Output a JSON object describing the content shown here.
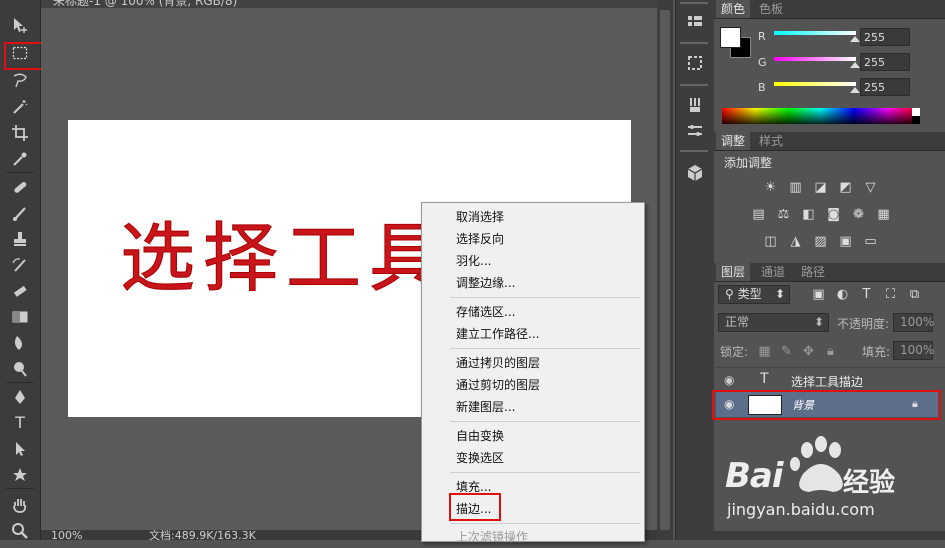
{
  "document": {
    "tab_title": "未标题-1 @ 100% (背景, RGB/8)",
    "canvas_text": "选择工具",
    "status_zoom": "100%",
    "status_info": "文档:489.9K/163.3K"
  },
  "toolbar": {
    "tools": [
      "move-tool",
      "rect-marquee-tool",
      "lasso-tool",
      "quick-select-tool",
      "crop-tool",
      "eyedropper-tool",
      "healing-brush-tool",
      "brush-tool",
      "clone-stamp-tool",
      "history-brush-tool",
      "eraser-tool",
      "gradient-tool",
      "blur-tool",
      "dodge-tool",
      "pen-tool",
      "type-tool",
      "path-select-tool",
      "shape-tool",
      "hand-tool",
      "zoom-tool"
    ],
    "type_tool_glyph": "T"
  },
  "context_menu": {
    "items": [
      {
        "label": "取消选择"
      },
      {
        "label": "选择反向"
      },
      {
        "label": "羽化..."
      },
      {
        "label": "调整边缘..."
      },
      {
        "label": "存储选区..."
      },
      {
        "label": "建立工作路径..."
      },
      {
        "label": "通过拷贝的图层"
      },
      {
        "label": "通过剪切的图层"
      },
      {
        "label": "新建图层..."
      },
      {
        "label": "自由变换"
      },
      {
        "label": "变换选区"
      },
      {
        "label": "填充..."
      },
      {
        "label": "描边..."
      },
      {
        "label": "上次滤镜操作"
      }
    ]
  },
  "color_panel": {
    "tabs": [
      "颜色",
      "色板"
    ],
    "channels": [
      {
        "name": "R",
        "value": "255"
      },
      {
        "name": "G",
        "value": "255"
      },
      {
        "name": "B",
        "value": "255"
      }
    ]
  },
  "adjust_panel": {
    "tabs": [
      "调整",
      "样式"
    ],
    "title": "添加调整"
  },
  "layers_panel": {
    "tabs": [
      "图层",
      "通道",
      "路径"
    ],
    "filter_label": "类型",
    "blend_mode": "正常",
    "opacity_label": "不透明度:",
    "opacity_value": "100%",
    "lock_label": "锁定:",
    "fill_label": "填充:",
    "fill_value": "100%",
    "layers": [
      {
        "name": "选择工具描边",
        "kind": "text",
        "kind_glyph": "T"
      },
      {
        "name": "背景",
        "kind": "image"
      }
    ]
  },
  "watermark": {
    "brand_left": "Bai",
    "brand_right": "经验",
    "url": "jingyan.baidu.com"
  }
}
